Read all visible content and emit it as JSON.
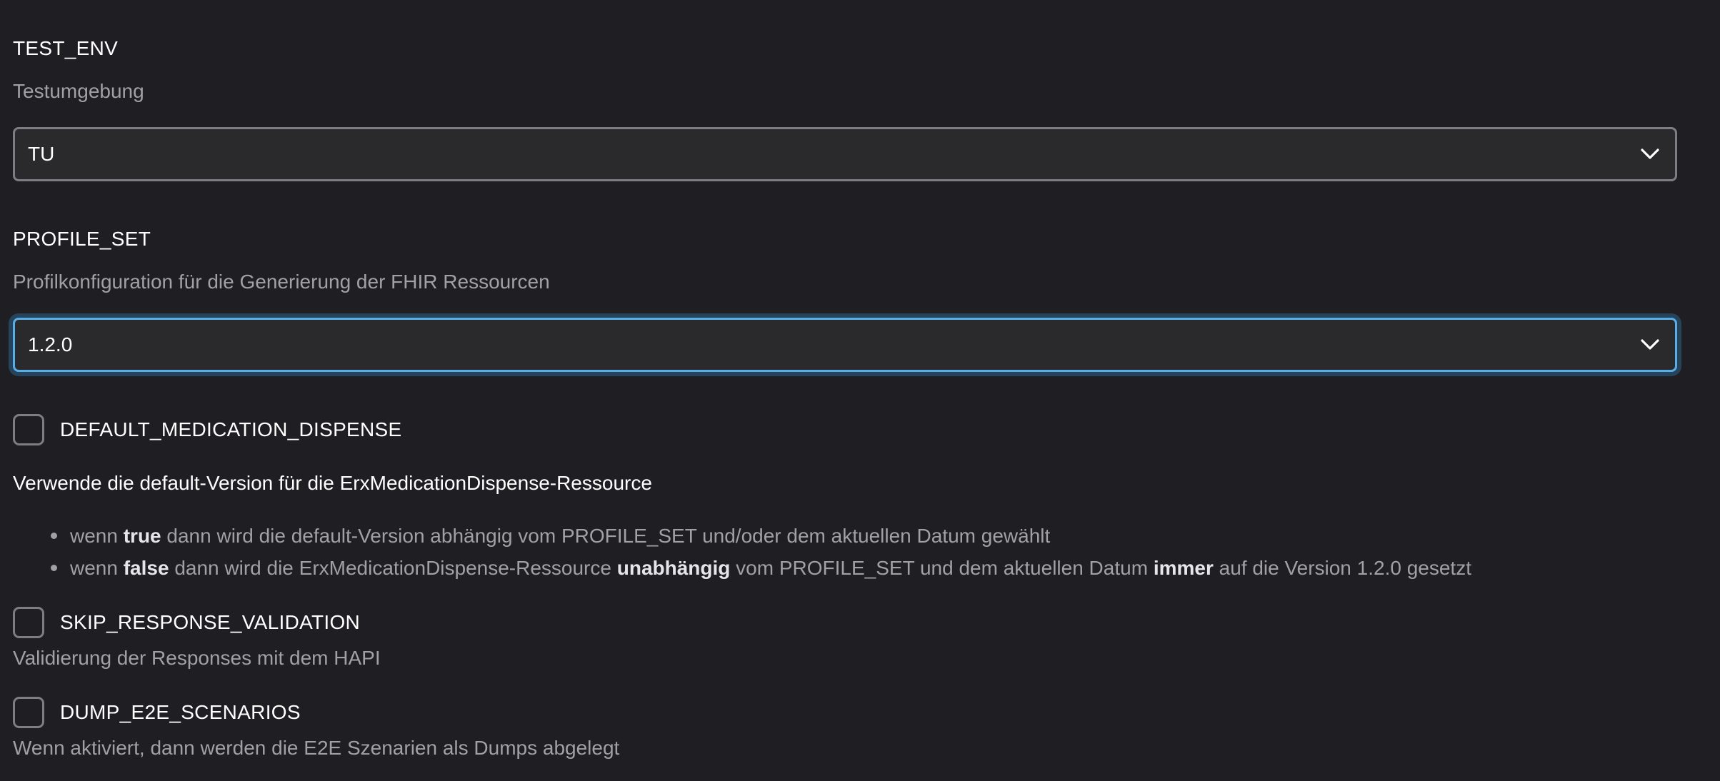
{
  "settings": {
    "test_env": {
      "title": "TEST_ENV",
      "description": "Testumgebung",
      "selected": "TU"
    },
    "profile_set": {
      "title": "PROFILE_SET",
      "description": "Profilkonfiguration für die Generierung der FHIR Ressourcen",
      "selected": "1.2.0"
    },
    "default_medication_dispense": {
      "label": "DEFAULT_MEDICATION_DISPENSE",
      "checked": false,
      "description": "Verwende die default-Version für die ErxMedicationDispense-Ressource",
      "bullets": [
        {
          "p1": "wenn ",
          "b1": "true",
          "p2": " dann wird die default-Version abhängig vom PROFILE_SET und/oder dem aktuellen Datum gewählt"
        },
        {
          "p1": "wenn ",
          "b1": "false",
          "p2": " dann wird die ErxMedicationDispense-Ressource ",
          "b2": "unabhängig",
          "p3": " vom PROFILE_SET und dem aktuellen Datum ",
          "b3": "immer",
          "p4": " auf die Version 1.2.0 gesetzt"
        }
      ]
    },
    "skip_response_validation": {
      "label": "SKIP_RESPONSE_VALIDATION",
      "checked": false,
      "description": "Validierung der Responses mit dem HAPI"
    },
    "dump_e2e_scenarios": {
      "label": "DUMP_E2E_SCENARIOS",
      "checked": false,
      "description": "Wenn aktiviert, dann werden die E2E Szenarien als Dumps abgelegt"
    }
  },
  "icons": {
    "select_chevron": "chevron-down-icon"
  },
  "colors": {
    "background": "#1f1f23",
    "focus_accent": "#5aaee8",
    "border": "#7d7d83",
    "muted_text": "#a0a0a6"
  }
}
